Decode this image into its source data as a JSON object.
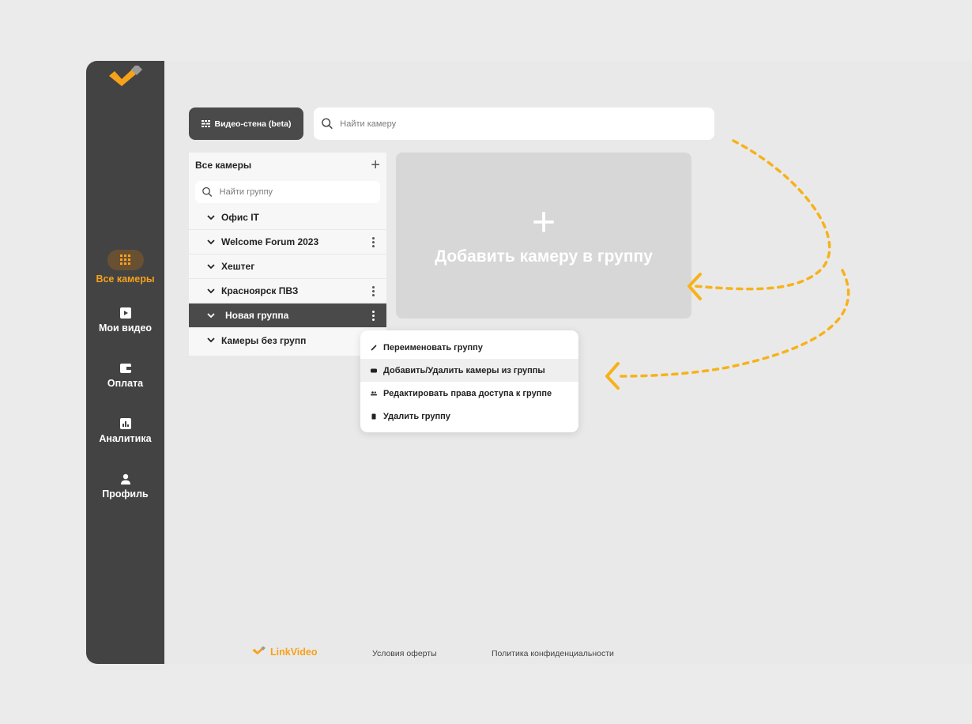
{
  "sidebar": {
    "items": [
      {
        "label": "Все камеры",
        "icon": "grid-icon",
        "active": true
      },
      {
        "label": "Мои видео",
        "icon": "play-icon"
      },
      {
        "label": "Оплата",
        "icon": "wallet-icon"
      },
      {
        "label": "Аналитика",
        "icon": "analytics-icon"
      },
      {
        "label": "Профиль",
        "icon": "person-icon"
      }
    ]
  },
  "topbar": {
    "wall_label": "Видео-стена (beta)",
    "search_placeholder": "Найти камеру"
  },
  "groups": {
    "title": "Все камеры",
    "search_placeholder": "Найти группу",
    "items": [
      {
        "label": "Офис IT",
        "has_menu": false
      },
      {
        "label": "Welcome Forum 2023",
        "has_menu": true
      },
      {
        "label": "Хештег",
        "has_menu": false
      },
      {
        "label": "Красноярск ПВЗ",
        "has_menu": true
      },
      {
        "label": "Новая группа",
        "has_menu": true,
        "selected": true
      },
      {
        "label": "Камеры без групп",
        "has_menu": false
      }
    ]
  },
  "add_card": {
    "label": "Добавить камеру в группу"
  },
  "context_menu": {
    "items": [
      {
        "label": "Переименовать группу",
        "icon": "pencil-icon"
      },
      {
        "label": "Добавить/Удалить камеры из группы",
        "icon": "camera-icon",
        "hover": true
      },
      {
        "label": "Редактировать права доступа к группе",
        "icon": "users-icon"
      },
      {
        "label": "Удалить группу",
        "icon": "trash-icon"
      }
    ]
  },
  "footer": {
    "brand": "LinkVideo",
    "terms": "Условия оферты",
    "privacy": "Политика конфиденциальности"
  },
  "colors": {
    "accent": "#f7a21b",
    "sidebar": "#434343",
    "selected_row": "#4a4a4a"
  }
}
